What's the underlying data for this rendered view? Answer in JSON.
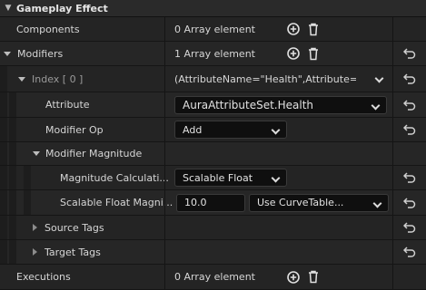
{
  "section": {
    "title": "Gameplay Effect"
  },
  "rows": {
    "components": {
      "label": "Components",
      "value": "0 Array element"
    },
    "modifiers": {
      "label": "Modifiers",
      "value": "1 Array element"
    },
    "index": {
      "label": "Index [ 0 ]",
      "value": "(AttributeName=\"Health\",Attribute=\"/Sc"
    },
    "attribute": {
      "label": "Attribute",
      "value": "AuraAttributeSet.Health"
    },
    "modifier_op": {
      "label": "Modifier Op",
      "value": "Add"
    },
    "modifier_magnitude": {
      "label": "Modifier Magnitude"
    },
    "magnitude_calc": {
      "label": "Magnitude Calculati...",
      "value": "Scalable Float"
    },
    "scalable_float": {
      "label": "Scalable Float Magni...",
      "value": "10.0",
      "curve": "Use CurveTable..."
    },
    "source_tags": {
      "label": "Source Tags"
    },
    "target_tags": {
      "label": "Target Tags"
    },
    "executions": {
      "label": "Executions",
      "value": "0 Array element"
    }
  },
  "icons": {
    "add": "add-circle-icon",
    "delete": "trash-icon",
    "reset": "reset-arrow-icon"
  }
}
